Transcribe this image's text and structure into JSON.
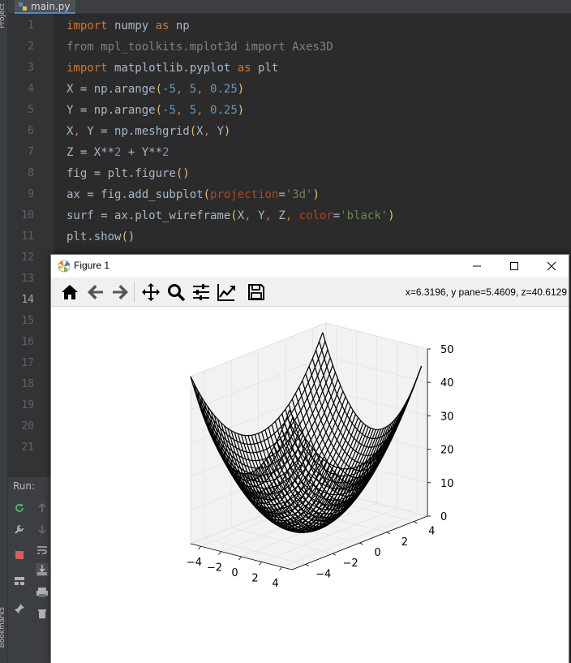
{
  "ide": {
    "side_strip_top": "Project",
    "side_strip_bottom": "Bookmarks",
    "tab_label": "main.py",
    "line_numbers": [
      "1",
      "2",
      "3",
      "4",
      "5",
      "6",
      "7",
      "8",
      "9",
      "10",
      "11",
      "12",
      "13",
      "14",
      "15",
      "16",
      "17",
      "18",
      "19",
      "20",
      "21"
    ],
    "current_line": "14",
    "code": [
      [
        [
          "kw",
          "import"
        ],
        [
          "t",
          " numpy "
        ],
        [
          "kw",
          "as"
        ],
        [
          "t",
          " np"
        ]
      ],
      [
        [
          "dim",
          "from mpl_toolkits.mplot3d import Axes3D"
        ]
      ],
      [
        [
          "kw",
          "import"
        ],
        [
          "t",
          " matplotlib.pyplot "
        ],
        [
          "kw",
          "as"
        ],
        [
          "t",
          " plt"
        ]
      ],
      [
        [
          "t",
          "X = np.arange"
        ],
        [
          "paren",
          "("
        ],
        [
          "num",
          "-5"
        ],
        [
          "kw",
          ", "
        ],
        [
          "num",
          "5"
        ],
        [
          "kw",
          ", "
        ],
        [
          "num",
          "0.25"
        ],
        [
          "paren",
          ")"
        ]
      ],
      [
        [
          "t",
          "Y = np.arange"
        ],
        [
          "paren",
          "("
        ],
        [
          "num",
          "-5"
        ],
        [
          "kw",
          ", "
        ],
        [
          "num",
          "5"
        ],
        [
          "kw",
          ", "
        ],
        [
          "num",
          "0.25"
        ],
        [
          "paren",
          ")"
        ]
      ],
      [
        [
          "t",
          "X"
        ],
        [
          "kw",
          ", "
        ],
        [
          "t",
          "Y = np.meshgrid"
        ],
        [
          "paren",
          "("
        ],
        [
          "t",
          "X"
        ],
        [
          "kw",
          ", "
        ],
        [
          "t",
          "Y"
        ],
        [
          "paren",
          ")"
        ]
      ],
      [
        [
          "t",
          "Z = X**"
        ],
        [
          "num",
          "2"
        ],
        [
          "t",
          " + Y**"
        ],
        [
          "num",
          "2"
        ]
      ],
      [
        [
          "t",
          "fig = plt.figure"
        ],
        [
          "paren",
          "()"
        ]
      ],
      [
        [
          "t",
          "ax = fig.add_subplot"
        ],
        [
          "paren",
          "("
        ],
        [
          "prm",
          "projection"
        ],
        [
          "t",
          "="
        ],
        [
          "str",
          "'3d'"
        ],
        [
          "paren",
          ")"
        ]
      ],
      [
        [
          "t",
          "surf = ax.plot_wireframe"
        ],
        [
          "paren",
          "("
        ],
        [
          "t",
          "X"
        ],
        [
          "kw",
          ", "
        ],
        [
          "t",
          "Y"
        ],
        [
          "kw",
          ", "
        ],
        [
          "t",
          "Z"
        ],
        [
          "kw",
          ", "
        ],
        [
          "prm",
          "color"
        ],
        [
          "t",
          "="
        ],
        [
          "str",
          "'black'"
        ],
        [
          "paren",
          ")"
        ]
      ],
      [
        [
          "t",
          "plt.show"
        ],
        [
          "paren",
          "()"
        ]
      ]
    ],
    "run_label": "Run:"
  },
  "figure": {
    "title": "Figure 1",
    "coords": "x=6.3196, y pane=5.4609, z=40.6129",
    "toolbar": [
      {
        "name": "home-icon",
        "tooltip": "Home"
      },
      {
        "name": "back-arrow-icon",
        "tooltip": "Back"
      },
      {
        "name": "forward-arrow-icon",
        "tooltip": "Forward"
      },
      {
        "name": "pan-move-icon",
        "tooltip": "Pan"
      },
      {
        "name": "zoom-magnifier-icon",
        "tooltip": "Zoom"
      },
      {
        "name": "configure-subplots-icon",
        "tooltip": "Subplots"
      },
      {
        "name": "edit-axes-icon",
        "tooltip": "Customize"
      },
      {
        "name": "save-floppy-icon",
        "tooltip": "Save"
      }
    ]
  },
  "chart_data": {
    "type": "wireframe3d",
    "function": "Z = X**2 + Y**2",
    "x": {
      "start": -5,
      "stop": 5,
      "step": 0.25
    },
    "y": {
      "start": -5,
      "stop": 5,
      "step": 0.25
    },
    "color": "black",
    "x_ticks": [
      "−4",
      "−2",
      "0",
      "2",
      "4"
    ],
    "y_ticks": [
      "−4",
      "−2",
      "0",
      "2",
      "4"
    ],
    "z_ticks": [
      "0",
      "10",
      "20",
      "30",
      "40",
      "50"
    ],
    "zlim": [
      0,
      50
    ],
    "pane_color": "#f2f2f2",
    "grid": true
  }
}
